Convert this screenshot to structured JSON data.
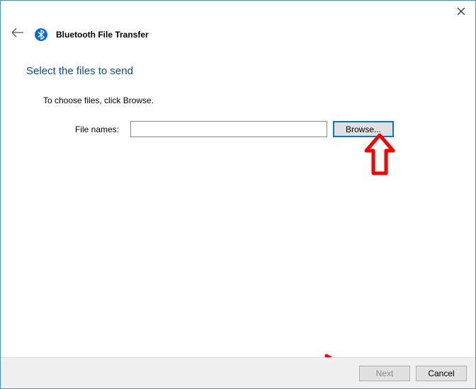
{
  "window": {
    "title": "Bluetooth File Transfer"
  },
  "main": {
    "heading": "Select the files to send",
    "instruction": "To choose files, click Browse.",
    "file_label": "File names:",
    "file_value": "",
    "browse_label": "Browse..."
  },
  "footer": {
    "next_label": "Next",
    "cancel_label": "Cancel",
    "next_enabled": false
  },
  "annotations": {
    "arrow_color": "#ff0000"
  }
}
